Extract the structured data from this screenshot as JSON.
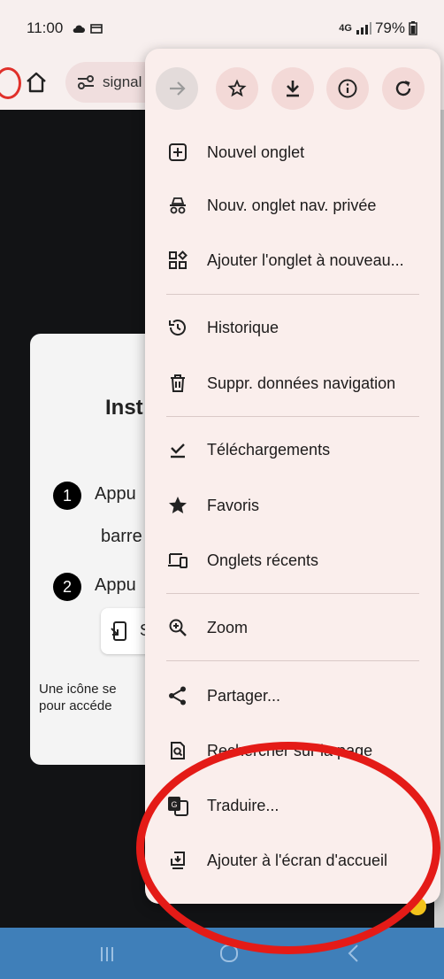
{
  "status_bar": {
    "time": "11:00",
    "network": "4G",
    "battery": "79%"
  },
  "url_bar": {
    "url_text": "signal"
  },
  "dialog": {
    "title": "Inst",
    "step1_number": "1",
    "step1_text_line1": "Appu",
    "step1_text_line2": "barre",
    "step2_number": "2",
    "step2_text": "Appu",
    "chip_text": "S",
    "footer_line1": "Une icône se",
    "footer_line2": "pour accéde"
  },
  "menu": {
    "toolbar": [
      "forward-icon",
      "star-icon",
      "download-icon",
      "info-icon",
      "refresh-icon"
    ],
    "items": [
      {
        "label": "Nouvel onglet",
        "icon": "plus-box-icon"
      },
      {
        "label": "Nouv. onglet nav. privée",
        "icon": "incognito-icon"
      },
      {
        "label": "Ajouter l'onglet à nouveau...",
        "icon": "tab-group-icon"
      },
      {
        "label": "Historique",
        "icon": "history-icon"
      },
      {
        "label": "Suppr. données navigation",
        "icon": "trash-icon"
      },
      {
        "label": "Téléchargements",
        "icon": "check-download-icon"
      },
      {
        "label": "Favoris",
        "icon": "star-filled-icon"
      },
      {
        "label": "Onglets récents",
        "icon": "devices-icon"
      },
      {
        "label": "Zoom",
        "icon": "zoom-icon"
      },
      {
        "label": "Partager...",
        "icon": "share-icon"
      },
      {
        "label": "Rechercher sur la page",
        "icon": "find-in-page-icon"
      },
      {
        "label": "Traduire...",
        "icon": "translate-icon"
      },
      {
        "label": "Ajouter à l'écran d'accueil",
        "icon": "add-to-home-icon"
      }
    ]
  },
  "colors": {
    "menu_bg": "#faeeec",
    "annotation": "#e41b17",
    "navbar": "#3f7fb9"
  }
}
